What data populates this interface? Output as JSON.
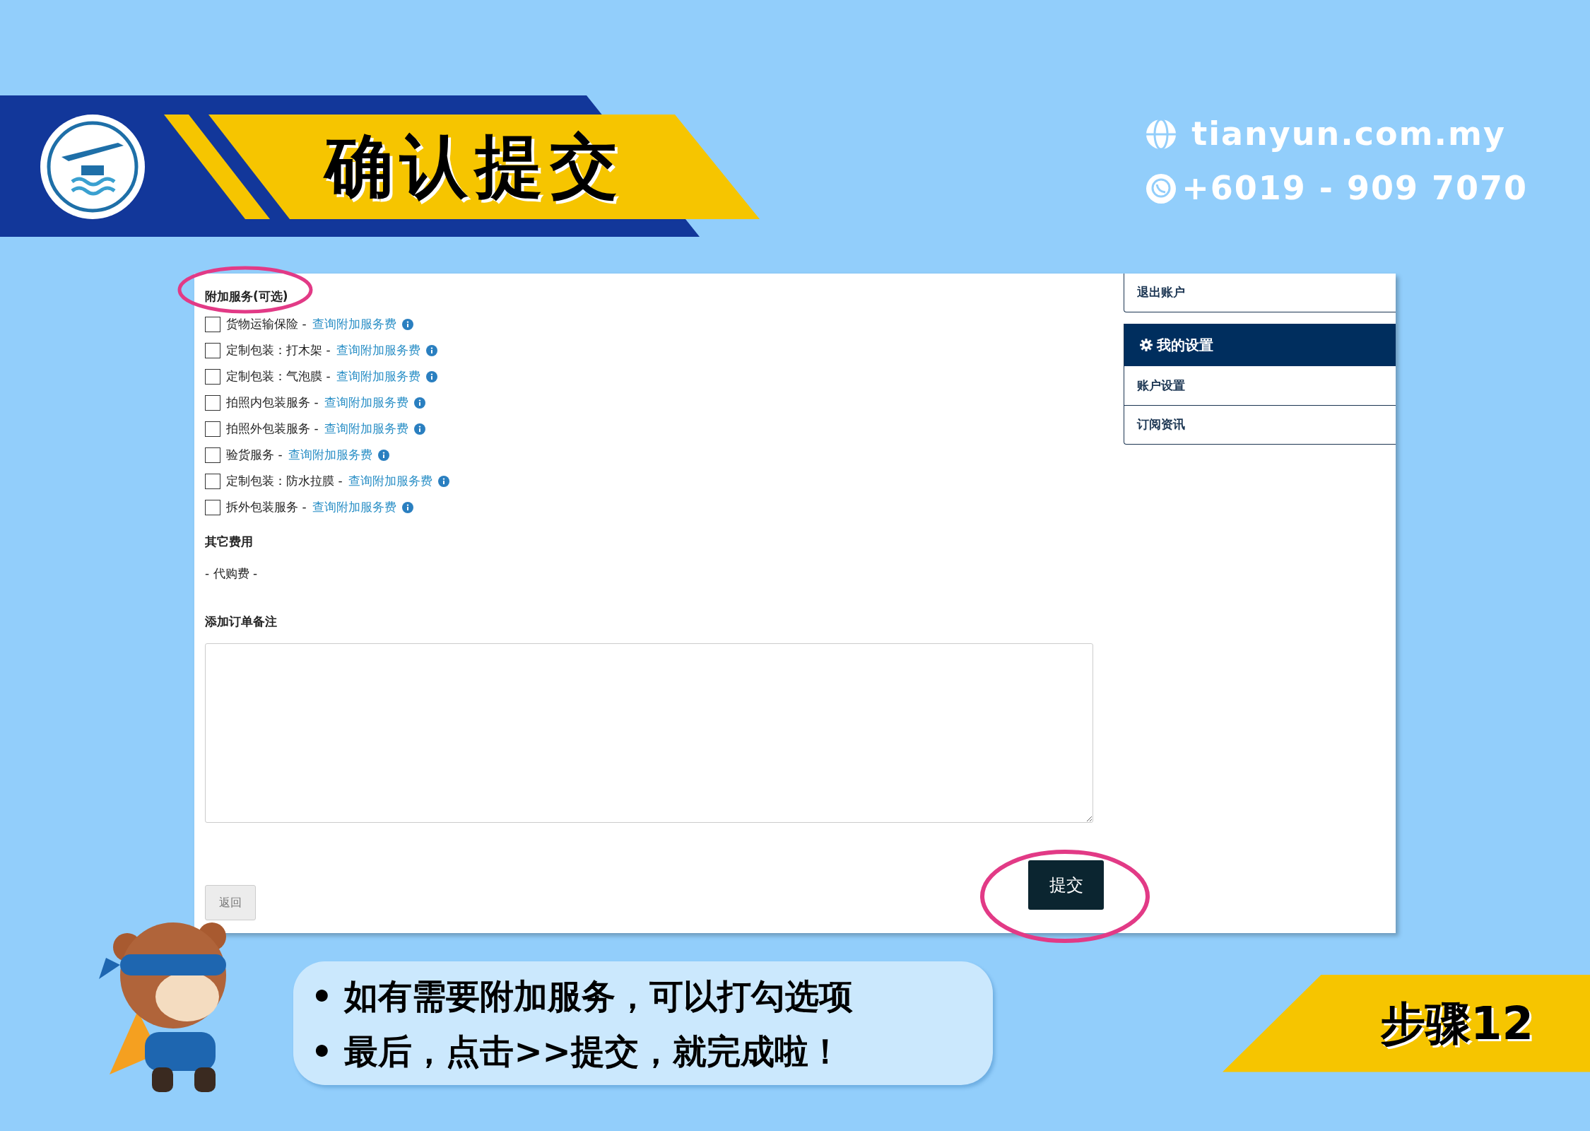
{
  "header": {
    "title": "确认提交",
    "website": "tianyun.com.my",
    "phone": "+6019 - 909 7070"
  },
  "form": {
    "services_heading": "附加服务(可选)",
    "services": [
      {
        "label": "货物运输保险 -",
        "link": "查询附加服务费",
        "checked": false
      },
      {
        "label": "定制包装：打木架 -",
        "link": "查询附加服务费",
        "checked": false
      },
      {
        "label": "定制包装：气泡膜 -",
        "link": "查询附加服务费",
        "checked": false
      },
      {
        "label": "拍照内包装服务 -",
        "link": "查询附加服务费",
        "checked": false
      },
      {
        "label": "拍照外包装服务 -",
        "link": "查询附加服务费",
        "checked": false
      },
      {
        "label": "验货服务 -",
        "link": "查询附加服务费",
        "checked": false
      },
      {
        "label": "定制包装：防水拉膜 -",
        "link": "查询附加服务费",
        "checked": false
      },
      {
        "label": "拆外包装服务 -",
        "link": "查询附加服务费",
        "checked": false
      }
    ],
    "other_fees_heading": "其它费用",
    "other_fees_item": "- 代购费 -",
    "notes_heading": "添加订单备注",
    "back_button": "返回",
    "submit_button": "提交"
  },
  "sidebar": {
    "logout": "退出账户",
    "settings_heading": "我的设置",
    "items": [
      "账户设置",
      "订阅资讯"
    ]
  },
  "tips": [
    "• 如有需要附加服务，可以打勾选项",
    "• 最后，点击>>提交，就完成啦！"
  ],
  "step": "步骤12"
}
